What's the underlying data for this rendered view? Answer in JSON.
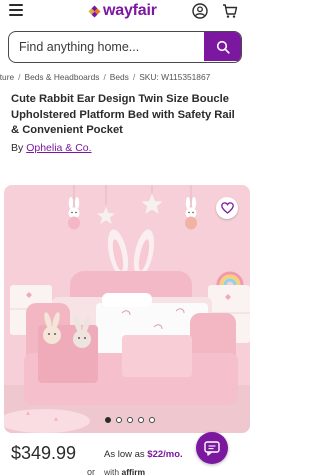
{
  "header": {
    "logo_text": "wayfair",
    "brand_color": "#7b189f",
    "icons": [
      "menu-icon",
      "wayfair-logo-icon",
      "account-icon",
      "cart-icon"
    ]
  },
  "search": {
    "placeholder": "Find anything home...",
    "value": "",
    "button_icon": "search-icon"
  },
  "breadcrumb": {
    "items": [
      "iiture",
      "Beds & Headboards",
      "Beds"
    ],
    "sku": "SKU: W115351867"
  },
  "product": {
    "title": "Cute Rabbit Ear Design Twin Size Boucle Upholstered Platform Bed with Safety Rail & Convenient Pocket",
    "by_prefix": "By",
    "brand": "Ophelia & Co."
  },
  "gallery": {
    "image_alt": "Pink rabbit-ear boucle twin bed with plush bunnies",
    "favorite_icon": "heart-icon",
    "dot_count": 5,
    "active_dot": 0
  },
  "pricing": {
    "price": "$349.99",
    "as_low_prefix": "As low as ",
    "monthly": "$22/mo.",
    "with_text": "with",
    "affirm": "affirm",
    "or_text": "or"
  },
  "chat": {
    "icon": "chat-icon"
  }
}
